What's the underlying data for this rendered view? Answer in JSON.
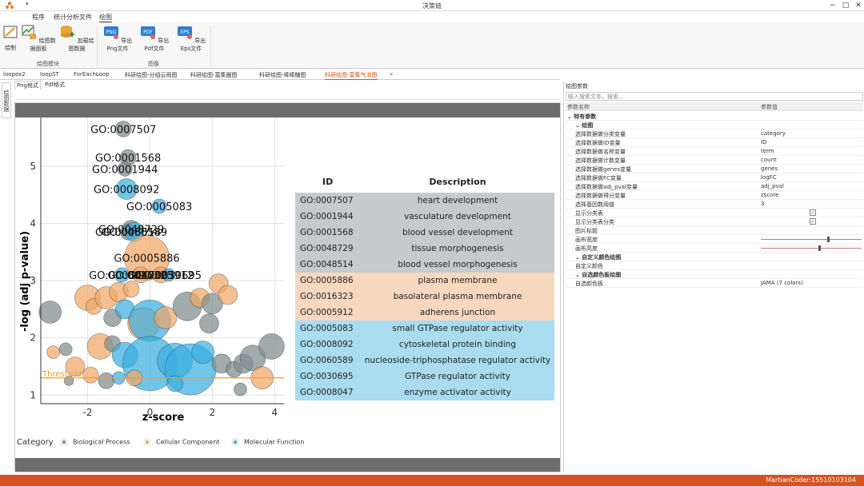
{
  "window": {
    "title": "决策链",
    "minimize": "−",
    "maximize": "□",
    "close": "✕"
  },
  "menu": {
    "items": [
      "程序",
      "统计分析文件",
      "绘图"
    ],
    "active": "绘图"
  },
  "ribbon": {
    "buttons": [
      {
        "label": "绘制",
        "icon": "draw-icon"
      },
      {
        "label": "绘图数据面板",
        "icon": "data-panel-icon"
      },
      {
        "label": "加载绘图数据",
        "icon": "load-data-icon"
      },
      {
        "label": "导出Png文件",
        "icon": "png-icon",
        "badge": "PNG"
      },
      {
        "label": "导出Pdf文件",
        "icon": "pdf-icon",
        "badge": "PDF"
      },
      {
        "label": "导出Eps文件",
        "icon": "eps-icon",
        "badge": "EPS"
      }
    ],
    "groups": [
      "绘图模块",
      "图像"
    ]
  },
  "doc_tabs": [
    "loopex2",
    "loopST",
    "ForEachLoop",
    "科研绘图-分组云雨图",
    "科研绘图-富集圈图",
    "科研绘图-棒棒糖图",
    "科研绘图-富集气泡图"
  ],
  "active_doc_tab": "科研绘图-富集气泡图",
  "doc_tab_close": "×",
  "side_tab": "绘图数据",
  "sub_tabs": [
    "Png格式",
    "Pdf格式"
  ],
  "chart_data": {
    "type": "scatter",
    "xlabel": "z-score",
    "ylabel": "-log (adj p-value)",
    "xlim": [
      -3.5,
      4.3
    ],
    "ylim": [
      0.85,
      5.85
    ],
    "xticks": [
      -2,
      0,
      2,
      4
    ],
    "yticks": [
      1,
      2,
      3,
      4,
      5
    ],
    "grid": true,
    "threshold": {
      "label": "Threshold",
      "y": 1.3
    },
    "legend_title": "Category",
    "legend_placement": "bottom",
    "series": [
      {
        "name": "Biological Process",
        "color": "#7f8c8d"
      },
      {
        "name": "Cellular Component",
        "color": "#f0a868"
      },
      {
        "name": "Molecular Function",
        "color": "#3aaee0"
      }
    ],
    "points": [
      {
        "label": "GO:0007507",
        "x": -0.85,
        "y": 5.65,
        "r": 10,
        "cat": 0
      },
      {
        "label": "GO:0001568",
        "x": -0.7,
        "y": 5.15,
        "r": 10,
        "cat": 0
      },
      {
        "label": "GO:0001944",
        "x": -0.8,
        "y": 4.95,
        "r": 9,
        "cat": 0
      },
      {
        "label": "GO:0008092",
        "x": -0.75,
        "y": 4.6,
        "r": 13,
        "cat": 2
      },
      {
        "label": "GO:0005083",
        "x": 0.3,
        "y": 4.3,
        "r": 9,
        "cat": 2
      },
      {
        "label": "GO:0048729",
        "x": -0.6,
        "y": 3.9,
        "r": 11,
        "cat": 0
      },
      {
        "label": "GO:0048514",
        "x": -0.7,
        "y": 3.85,
        "r": 10,
        "cat": 0
      },
      {
        "label": "GO:0060589",
        "x": -0.5,
        "y": 3.85,
        "r": 12,
        "cat": 2
      },
      {
        "label": "GO:0005886",
        "x": -0.1,
        "y": 3.4,
        "r": 28,
        "cat": 1
      },
      {
        "label": "GO:0016323",
        "x": -0.3,
        "y": 3.1,
        "r": 10,
        "cat": 1
      },
      {
        "label": "GO:0005912",
        "x": 0.35,
        "y": 3.1,
        "r": 10,
        "cat": 1
      },
      {
        "label": "GO:0030695",
        "x": 0.6,
        "y": 3.1,
        "r": 8,
        "cat": 2
      },
      {
        "label": "GO:0008047",
        "x": -0.9,
        "y": 3.1,
        "r": 9,
        "cat": 2
      }
    ],
    "bubbles": [
      {
        "x": -3.2,
        "y": 2.45,
        "r": 14,
        "cat": 0
      },
      {
        "x": -2.0,
        "y": 2.7,
        "r": 16,
        "cat": 1
      },
      {
        "x": -1.8,
        "y": 2.55,
        "r": 10,
        "cat": 1
      },
      {
        "x": -1.4,
        "y": 2.7,
        "r": 14,
        "cat": 1
      },
      {
        "x": -1.2,
        "y": 2.35,
        "r": 11,
        "cat": 0
      },
      {
        "x": -1.0,
        "y": 2.8,
        "r": 12,
        "cat": 1
      },
      {
        "x": -0.8,
        "y": 2.5,
        "r": 12,
        "cat": 2
      },
      {
        "x": -0.6,
        "y": 2.85,
        "r": 10,
        "cat": 1
      },
      {
        "x": -0.2,
        "y": 2.25,
        "r": 20,
        "cat": 1
      },
      {
        "x": 0.0,
        "y": 2.3,
        "r": 26,
        "cat": 2
      },
      {
        "x": 0.5,
        "y": 2.35,
        "r": 14,
        "cat": 1
      },
      {
        "x": 1.2,
        "y": 2.55,
        "r": 18,
        "cat": 0
      },
      {
        "x": 1.6,
        "y": 2.7,
        "r": 12,
        "cat": 1
      },
      {
        "x": 2.0,
        "y": 2.6,
        "r": 13,
        "cat": 0
      },
      {
        "x": 2.2,
        "y": 2.95,
        "r": 12,
        "cat": 1
      },
      {
        "x": 2.5,
        "y": 2.75,
        "r": 12,
        "cat": 1
      },
      {
        "x": 1.9,
        "y": 2.25,
        "r": 12,
        "cat": 0
      },
      {
        "x": -1.6,
        "y": 1.85,
        "r": 16,
        "cat": 1
      },
      {
        "x": -1.2,
        "y": 1.9,
        "r": 10,
        "cat": 0
      },
      {
        "x": -0.8,
        "y": 1.7,
        "r": 16,
        "cat": 2
      },
      {
        "x": 0.0,
        "y": 1.55,
        "r": 34,
        "cat": 2
      },
      {
        "x": 0.8,
        "y": 1.6,
        "r": 22,
        "cat": 2
      },
      {
        "x": 1.3,
        "y": 1.45,
        "r": 32,
        "cat": 2
      },
      {
        "x": 1.7,
        "y": 1.75,
        "r": 14,
        "cat": 2
      },
      {
        "x": 2.3,
        "y": 1.55,
        "r": 12,
        "cat": 0
      },
      {
        "x": 2.7,
        "y": 1.45,
        "r": 10,
        "cat": 0
      },
      {
        "x": 3.0,
        "y": 1.55,
        "r": 12,
        "cat": 0
      },
      {
        "x": 3.3,
        "y": 1.65,
        "r": 16,
        "cat": 0
      },
      {
        "x": 3.9,
        "y": 1.85,
        "r": 16,
        "cat": 0
      },
      {
        "x": 3.6,
        "y": 1.3,
        "r": 14,
        "cat": 1
      },
      {
        "x": -3.1,
        "y": 1.75,
        "r": 8,
        "cat": 1
      },
      {
        "x": -2.7,
        "y": 1.8,
        "r": 8,
        "cat": 0
      },
      {
        "x": -2.4,
        "y": 1.5,
        "r": 12,
        "cat": 1
      },
      {
        "x": -2.6,
        "y": 1.25,
        "r": 6,
        "cat": 0
      },
      {
        "x": -1.9,
        "y": 1.35,
        "r": 10,
        "cat": 1
      },
      {
        "x": -1.4,
        "y": 1.25,
        "r": 10,
        "cat": 0
      },
      {
        "x": -1.0,
        "y": 1.3,
        "r": 8,
        "cat": 2
      },
      {
        "x": -0.5,
        "y": 1.3,
        "r": 10,
        "cat": 1
      },
      {
        "x": 2.9,
        "y": 1.1,
        "r": 8,
        "cat": 0
      },
      {
        "x": 0.8,
        "y": 1.2,
        "r": 10,
        "cat": 2
      }
    ]
  },
  "go_table": {
    "headers": [
      "ID",
      "Description"
    ],
    "rows": [
      {
        "id": "GO:0007507",
        "desc": "heart development",
        "cat": 0
      },
      {
        "id": "GO:0001944",
        "desc": "vasculature development",
        "cat": 0
      },
      {
        "id": "GO:0001568",
        "desc": "blood vessel development",
        "cat": 0
      },
      {
        "id": "GO:0048729",
        "desc": "tissue morphogenesis",
        "cat": 0
      },
      {
        "id": "GO:0048514",
        "desc": "blood vessel morphogenesis",
        "cat": 0
      },
      {
        "id": "GO:0005886",
        "desc": "plasma membrane",
        "cat": 1
      },
      {
        "id": "GO:0016323",
        "desc": "basolateral plasma membrane",
        "cat": 1
      },
      {
        "id": "GO:0005912",
        "desc": "adherens junction",
        "cat": 1
      },
      {
        "id": "GO:0005083",
        "desc": "small GTPase regulator activity",
        "cat": 2
      },
      {
        "id": "GO:0008092",
        "desc": "cytoskeletal protein binding",
        "cat": 2
      },
      {
        "id": "GO:0060589",
        "desc": "nucleoside-triphosphatase regulator activity",
        "cat": 2
      },
      {
        "id": "GO:0030695",
        "desc": "GTPase regulator activity",
        "cat": 2
      },
      {
        "id": "GO:0008047",
        "desc": "enzyme activator activity",
        "cat": 2
      }
    ],
    "row_colors": [
      "#c5cacd",
      "#f6d8bf",
      "#a9dcef"
    ]
  },
  "props": {
    "title": "绘图参数",
    "search_placeholder": "输入搜索文本，搜索...",
    "col_name": "参数名称",
    "col_value": "参数值",
    "rows": [
      {
        "name": "特有参数",
        "value": "",
        "kind": "section"
      },
      {
        "name": "绘图",
        "value": "",
        "kind": "section"
      },
      {
        "name": "选择数据做分类变量",
        "value": "category",
        "kind": "text"
      },
      {
        "name": "选择数据做ID变量",
        "value": "ID",
        "kind": "text"
      },
      {
        "name": "选择数据做名称变量",
        "value": "term",
        "kind": "text"
      },
      {
        "name": "选择数据做计数变量",
        "value": "count",
        "kind": "text"
      },
      {
        "name": "选择数据做genes变量",
        "value": "genes",
        "kind": "text"
      },
      {
        "name": "选择数据做FC变量",
        "value": "logFC",
        "kind": "text"
      },
      {
        "name": "选择数据做adj_pval变量",
        "value": "adj_pval",
        "kind": "text"
      },
      {
        "name": "选择数据做得分变量",
        "value": "zscore",
        "kind": "text"
      },
      {
        "name": "选择基因数阈值",
        "value": "3",
        "kind": "text"
      },
      {
        "name": "显示分类表",
        "value": "✓",
        "kind": "check"
      },
      {
        "name": "显示分类表分类",
        "value": "✓",
        "kind": "check"
      },
      {
        "name": "图片标题",
        "value": "",
        "kind": "text"
      },
      {
        "name": "画布宽度",
        "value": "",
        "kind": "slider",
        "level": 0.66
      },
      {
        "name": "画布高度",
        "value": "",
        "kind": "slider",
        "level": 0.57
      },
      {
        "name": "自定义颜色绘图",
        "value": "",
        "kind": "section"
      },
      {
        "name": "自定义颜色",
        "value": "",
        "kind": "text"
      },
      {
        "name": "自选颜色板绘图",
        "value": "",
        "kind": "section"
      },
      {
        "name": "自选颜色板",
        "value": "JAMA (7 colors)",
        "kind": "text"
      }
    ]
  },
  "status": {
    "text": "MartianCoder:15510103104"
  },
  "colors": {
    "accent": "#d6521e",
    "bar": "#6d6d6d"
  }
}
